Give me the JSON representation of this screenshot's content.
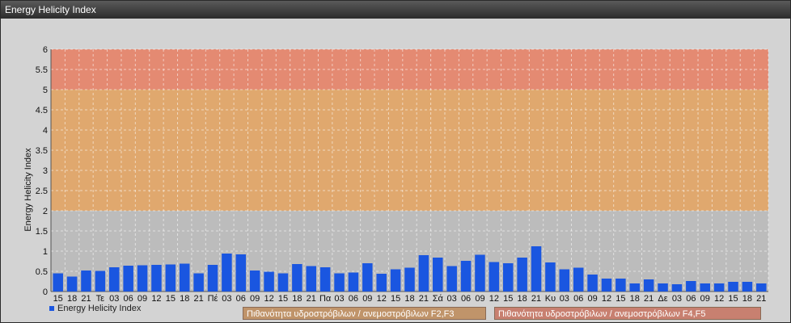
{
  "window": {
    "title": "Energy Helicity Index"
  },
  "legend": {
    "series_label": "Energy Helicity Index"
  },
  "zones": [
    {
      "label": "Πιθανότητα υδροστρόβιλων / ανεμοστρόβιλων F2,F3"
    },
    {
      "label": "Πιθανότητα υδροστρόβιλων / ανεμοστρόβιλων F4,F5"
    }
  ],
  "colors": {
    "bar": "#1a56e0",
    "band_low": "#bcbcbc",
    "band_mid": "#e0a86e",
    "band_high": "#e48a72"
  },
  "chart_data": {
    "type": "bar",
    "title": "",
    "xlabel": "",
    "ylabel": "Energy Helicity Index",
    "ylim": [
      0,
      6
    ],
    "yticks": [
      "0",
      "0.5",
      "1",
      "1.5",
      "2",
      "2.5",
      "3",
      "3.5",
      "4",
      "4.5",
      "5",
      "5.5",
      "6"
    ],
    "grid": true,
    "bands": [
      {
        "from": 0,
        "to": 2
      },
      {
        "from": 2,
        "to": 5
      },
      {
        "from": 5,
        "to": 6
      }
    ],
    "categories": [
      "15",
      "18",
      "21",
      "Τε",
      "03",
      "06",
      "09",
      "12",
      "15",
      "18",
      "21",
      "Πέ",
      "03",
      "06",
      "09",
      "12",
      "15",
      "18",
      "21",
      "Πα",
      "03",
      "06",
      "09",
      "12",
      "15",
      "18",
      "21",
      "Σά",
      "03",
      "06",
      "09",
      "12",
      "15",
      "18",
      "21",
      "Κυ",
      "03",
      "06",
      "09",
      "12",
      "15",
      "18",
      "21",
      "Δε",
      "03",
      "06",
      "09",
      "12",
      "15",
      "18",
      "21"
    ],
    "series": [
      {
        "name": "Energy Helicity Index",
        "values": [
          0.45,
          0.37,
          0.52,
          0.51,
          0.6,
          0.64,
          0.65,
          0.66,
          0.67,
          0.69,
          0.45,
          0.66,
          0.94,
          0.92,
          0.52,
          0.49,
          0.45,
          0.68,
          0.63,
          0.6,
          0.45,
          0.47,
          0.7,
          0.44,
          0.55,
          0.59,
          0.9,
          0.84,
          0.63,
          0.76,
          0.91,
          0.73,
          0.7,
          0.84,
          1.12,
          0.72,
          0.55,
          0.59,
          0.42,
          0.32,
          0.32,
          0.2,
          0.3,
          0.2,
          0.18,
          0.26,
          0.2,
          0.2,
          0.24,
          0.24,
          0.2
        ]
      }
    ]
  }
}
